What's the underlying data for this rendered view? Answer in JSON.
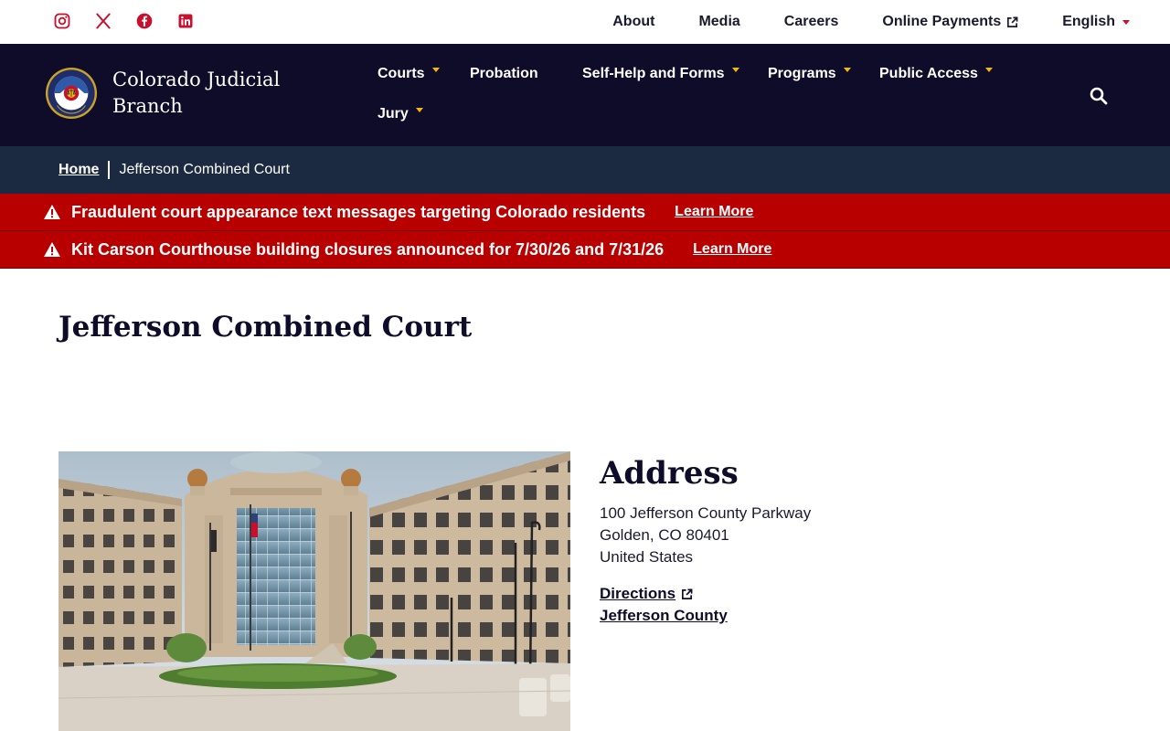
{
  "utility": {
    "social": [
      {
        "name": "instagram-icon"
      },
      {
        "name": "x-twitter-icon"
      },
      {
        "name": "facebook-icon"
      },
      {
        "name": "linkedin-icon"
      }
    ],
    "links": {
      "about": "About",
      "media": "Media",
      "careers": "Careers",
      "online_payments": "Online Payments",
      "language": "English"
    }
  },
  "header": {
    "brand_line1": "Colorado Judicial",
    "brand_line2": "Branch",
    "nav": {
      "courts": "Courts",
      "probation": "Probation",
      "self_help": "Self-Help and Forms",
      "programs": "Programs",
      "public_access": "Public Access",
      "jury": "Jury"
    }
  },
  "breadcrumb": {
    "home": "Home",
    "current": "Jefferson Combined Court"
  },
  "alerts": [
    {
      "text": "Fraudulent court appearance text messages targeting Colorado residents",
      "link": "Learn More"
    },
    {
      "text": "Kit Carson Courthouse building closures announced for 7/30/26 and 7/31/26",
      "link": "Learn More"
    }
  ],
  "main": {
    "title": "Jefferson Combined Court",
    "address_heading": "Address",
    "address": {
      "line1": "100 Jefferson County Parkway",
      "line2": "Golden, CO 80401",
      "line3": "United States"
    },
    "links": {
      "directions": "Directions",
      "county": "Jefferson County"
    }
  },
  "colors": {
    "navy": "#0e0c29",
    "breadcrumb_bg": "#1b2a40",
    "alert_red": "#b80000",
    "accent_red": "#c8102e",
    "accent_gold": "#f5b70a"
  }
}
